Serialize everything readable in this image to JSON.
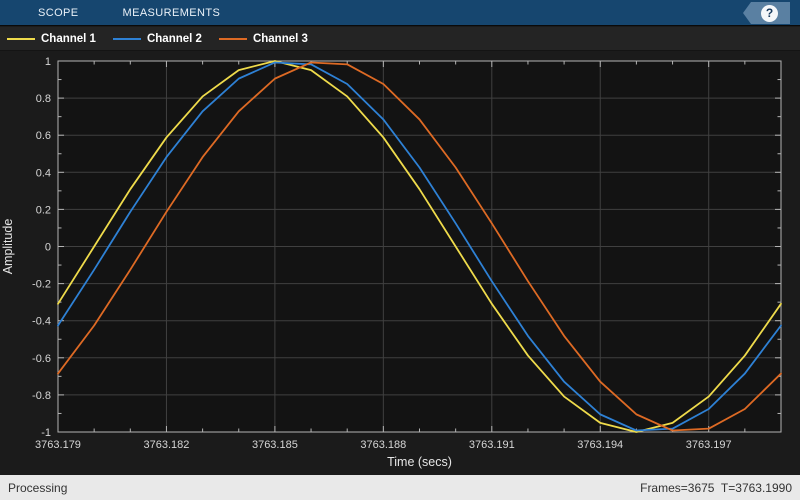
{
  "colors": {
    "toolbar_bg": "#16466F",
    "toolbar_text": "#EAF1F8",
    "help_tag_bg": "#5A80A2",
    "help_circle_bg": "#F4F7FA",
    "help_mark": "#173A5E",
    "legend_bg": "#242424",
    "legend_text": "#FFFFFF",
    "figure_bg": "#1B1B1B",
    "plot_bg": "#131313",
    "grid": "#404040",
    "axis_box": "#B4B4B4",
    "tick_text": "#D6D6D6",
    "label_text": "#E6E6E6",
    "status_bg": "#E9E9E9",
    "status_text": "#333333"
  },
  "toolbar": {
    "tabs": [
      {
        "label": "SCOPE"
      },
      {
        "label": "MEASUREMENTS"
      }
    ],
    "help_label": "?"
  },
  "status_bar": {
    "left": "Processing",
    "right": "Frames=3675  T=3763.1990"
  },
  "chart_data": {
    "type": "line",
    "title": "",
    "xlabel": "Time (secs)",
    "ylabel": "Amplitude",
    "xlim": [
      3763.179,
      3763.199
    ],
    "ylim": [
      -1,
      1
    ],
    "grid": true,
    "legend_position": "top",
    "background": "dark",
    "x_ticks": [
      3763.179,
      3763.182,
      3763.185,
      3763.188,
      3763.191,
      3763.194,
      3763.197
    ],
    "x_tick_labels": [
      "3763.179",
      "3763.182",
      "3763.185",
      "3763.188",
      "3763.191",
      "3763.194",
      "3763.197"
    ],
    "x_minor_step": 0.001,
    "y_ticks": [
      -1,
      -0.8,
      -0.6,
      -0.4,
      -0.2,
      0,
      0.2,
      0.4,
      0.6,
      0.8,
      1
    ],
    "y_tick_labels": [
      "-1",
      "-0.8",
      "-0.6",
      "-0.4",
      "-0.2",
      "0",
      "0.2",
      "0.4",
      "0.6",
      "0.8",
      "1"
    ],
    "y_minor_step": 0.1,
    "x": [
      3763.179,
      3763.18,
      3763.181,
      3763.182,
      3763.183,
      3763.184,
      3763.185,
      3763.186,
      3763.187,
      3763.188,
      3763.189,
      3763.19,
      3763.191,
      3763.192,
      3763.193,
      3763.194,
      3763.195,
      3763.196,
      3763.197,
      3763.198,
      3763.199
    ],
    "series": [
      {
        "name": "Channel 1",
        "color": "#EFDB4B",
        "values": [
          -0.309,
          0.0,
          0.309,
          0.588,
          0.809,
          0.951,
          1.0,
          0.951,
          0.809,
          0.588,
          0.309,
          0.0,
          -0.309,
          -0.588,
          -0.809,
          -0.951,
          -1.0,
          -0.951,
          -0.809,
          -0.588,
          -0.309
        ]
      },
      {
        "name": "Channel 2",
        "color": "#2E81D5",
        "values": [
          -0.426,
          -0.125,
          0.187,
          0.482,
          0.729,
          0.905,
          0.992,
          0.982,
          0.876,
          0.685,
          0.426,
          0.125,
          -0.187,
          -0.482,
          -0.729,
          -0.905,
          -0.992,
          -0.982,
          -0.876,
          -0.685,
          -0.426
        ]
      },
      {
        "name": "Channel 3",
        "color": "#DE6A24",
        "values": [
          -0.685,
          -0.426,
          -0.125,
          0.187,
          0.482,
          0.729,
          0.905,
          0.992,
          0.982,
          0.876,
          0.685,
          0.426,
          0.125,
          -0.187,
          -0.482,
          -0.729,
          -0.905,
          -0.992,
          -0.982,
          -0.876,
          -0.685
        ]
      }
    ]
  }
}
